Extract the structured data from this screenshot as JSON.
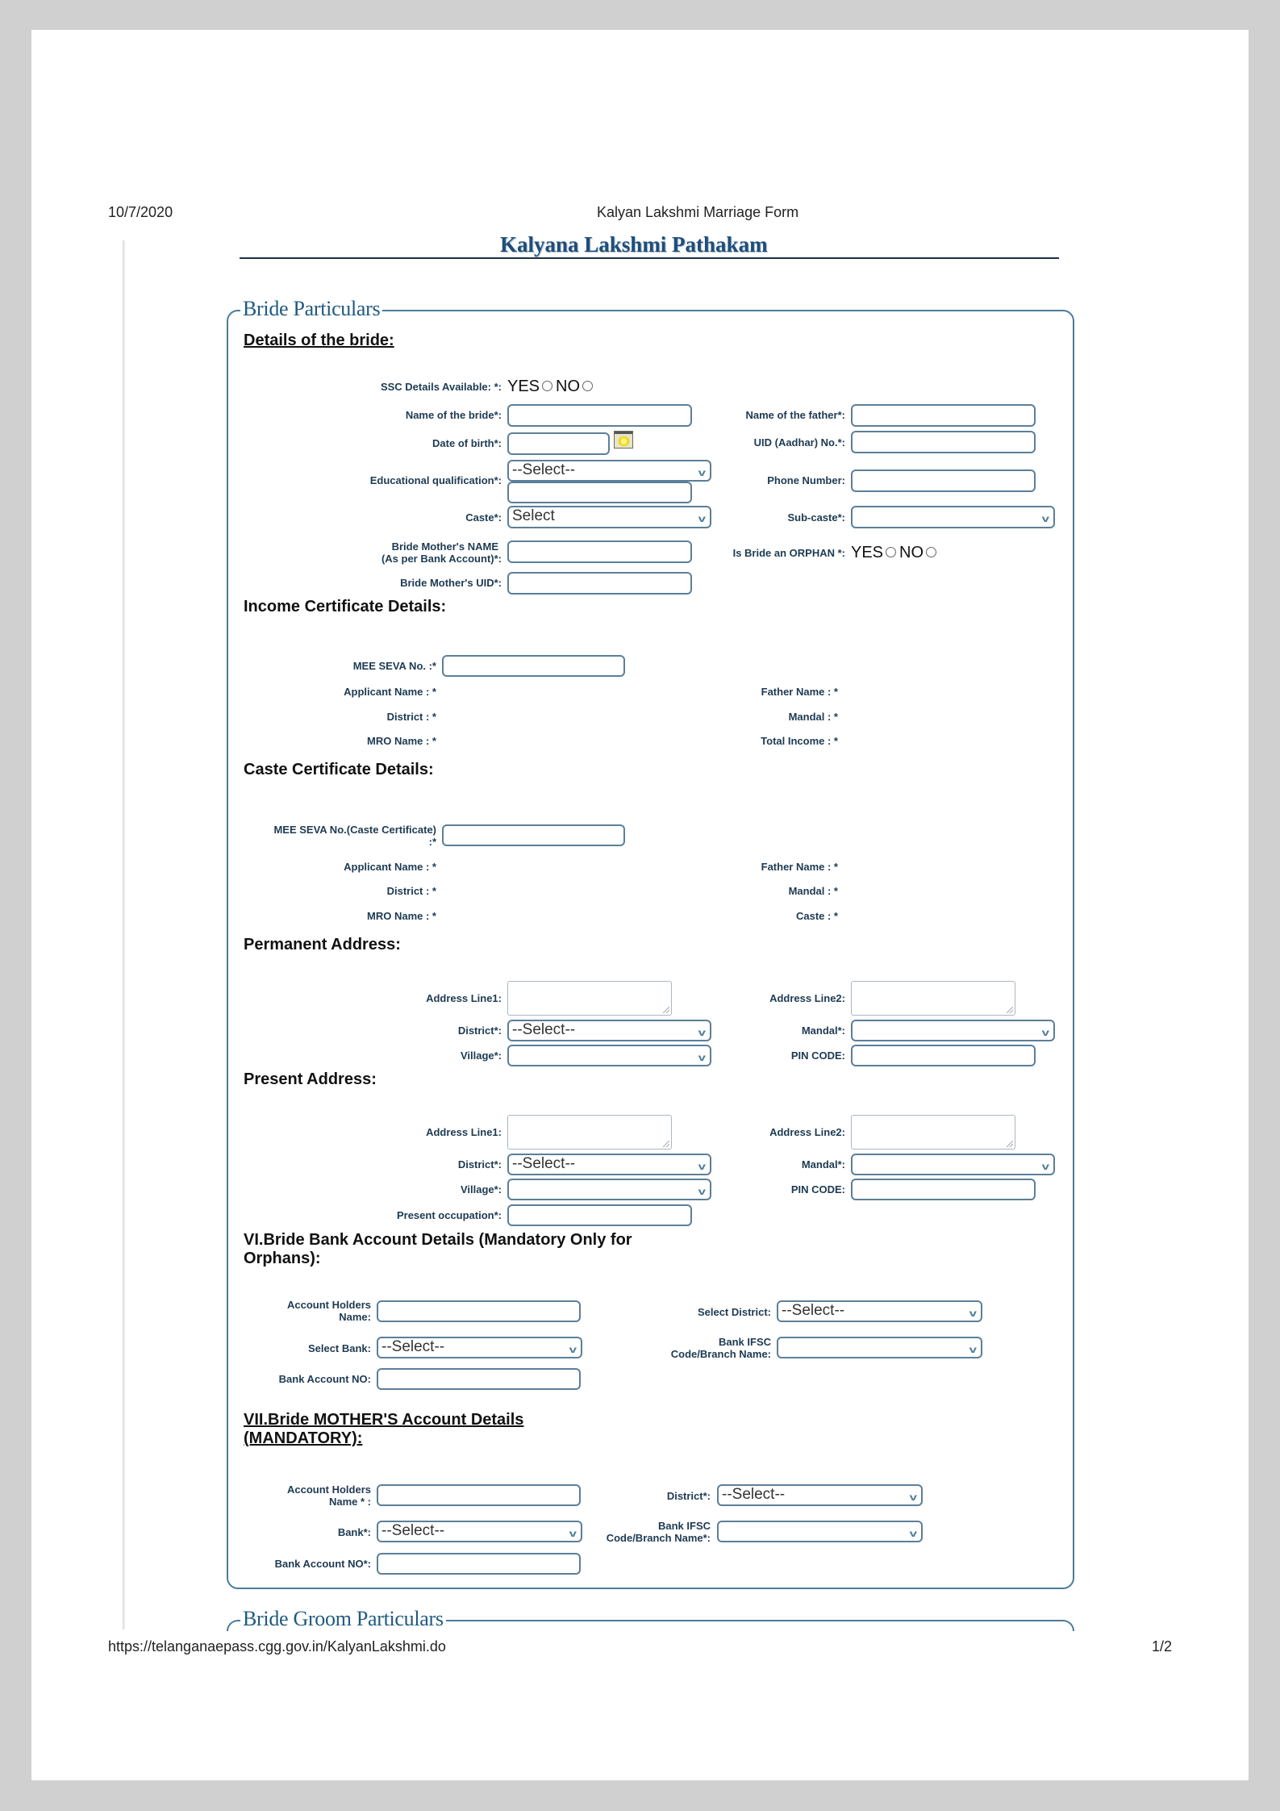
{
  "print_header": {
    "date": "10/7/2020",
    "doc_title": "Kalyan Lakshmi Marriage Form"
  },
  "print_footer": {
    "url": "https://telanganaepass.cgg.gov.in/KalyanLakshmi.do",
    "page": "1/2"
  },
  "page_title": "Kalyana Lakshmi Pathakam",
  "bride": {
    "legend": "Bride Particulars",
    "details_heading": "Details of the bride:",
    "ssc_label": "SSC Details Available: *:",
    "yes": "YES",
    "no": "NO",
    "name_label": "Name of the bride*:",
    "father_label": "Name of the father*:",
    "dob_label": "Date of birth*:",
    "uid_label": "UID (Aadhar) No.*:",
    "edu_label": "Educational qualification*:",
    "edu_value": "--Select--",
    "phone_label": "Phone Number:",
    "caste_label": "Caste*:",
    "caste_value": "Select",
    "subcaste_label": "Sub-caste*:",
    "subcaste_value": "",
    "mother_name_label_1": "Bride Mother's NAME",
    "mother_name_label_2": "(As per Bank Account)*:",
    "orphan_label": "Is Bride an ORPHAN *:",
    "mother_uid_label": "Bride Mother's UID*:"
  },
  "income": {
    "heading": "Income Certificate Details:",
    "meeseva_label": "MEE SEVA No. :*",
    "applicant_label": "Applicant Name : *",
    "father_label": "Father Name : *",
    "district_label": "District : *",
    "mandal_label": "Mandal : *",
    "mro_label": "MRO Name : *",
    "total_income_label": "Total Income : *"
  },
  "caste_cert": {
    "heading": "Caste Certificate Details:",
    "meeseva_label_1": "MEE SEVA No.(Caste Certificate)",
    "meeseva_label_2": ":*",
    "applicant_label": "Applicant Name : *",
    "father_label": "Father Name : *",
    "district_label": "District : *",
    "mandal_label": "Mandal : *",
    "mro_label": "MRO Name : *",
    "caste_label": "Caste : *"
  },
  "permanent_address": {
    "heading": "Permanent Address:",
    "line1_label": "Address Line1:",
    "line2_label": "Address Line2:",
    "district_label": "District*:",
    "district_value": "--Select--",
    "mandal_label": "Mandal*:",
    "mandal_value": "",
    "village_label": "Village*:",
    "village_value": "",
    "pin_label": "PIN CODE:"
  },
  "present_address": {
    "heading": "Present Address:",
    "line1_label": "Address Line1:",
    "line2_label": "Address Line2:",
    "district_label": "District*:",
    "district_value": "--Select--",
    "mandal_label": "Mandal*:",
    "mandal_value": "",
    "village_label": "Village*:",
    "village_value": "",
    "pin_label": "PIN CODE:",
    "occupation_label": "Present occupation*:"
  },
  "bride_bank": {
    "heading_1": "VI.Bride Bank Account Details (Mandatory Only for",
    "heading_2": "Orphans):",
    "holder_label_1": "Account Holders",
    "holder_label_2": "Name:",
    "district_label": "Select District:",
    "district_value": "--Select--",
    "bank_label": "Select Bank:",
    "bank_value": "--Select--",
    "ifsc_label_1": "Bank IFSC",
    "ifsc_label_2": "Code/Branch Name:",
    "ifsc_value": "",
    "account_label": "Bank Account NO:"
  },
  "mother_bank": {
    "heading_1": "VII.Bride MOTHER'S Account Details",
    "heading_2": "(MANDATORY):",
    "holder_label_1": "Account Holders",
    "holder_label_2": "Name * :",
    "district_label": "District*:",
    "district_value": "--Select--",
    "bank_label": "Bank*:",
    "bank_value": "--Select--",
    "ifsc_label_1": "Bank IFSC",
    "ifsc_label_2": "Code/Branch Name*:",
    "ifsc_value": "",
    "account_label": "Bank Account NO*:"
  },
  "groom": {
    "legend": "Bride Groom Particulars"
  },
  "icons": {
    "calendar": "calendar-icon",
    "dropdown": "chevron-down-icon",
    "radio": "radio-button"
  },
  "colors": {
    "title": "#1f4e79",
    "fieldset_border": "#4a7c99",
    "input_border": "#5b7f99",
    "label": "#1e3a52",
    "frame": "#d0d0d0"
  }
}
